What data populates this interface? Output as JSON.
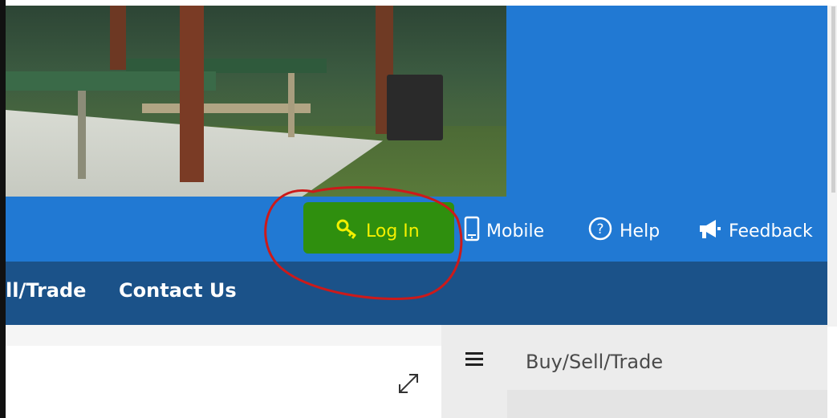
{
  "header": {
    "links": [
      {
        "id": "login",
        "label": "Log In",
        "icon": "key-icon"
      },
      {
        "id": "mobile",
        "label": "Mobile",
        "icon": "mobile-phone-icon"
      },
      {
        "id": "help",
        "label": "Help",
        "icon": "help-circle-icon"
      },
      {
        "id": "feedback",
        "label": "Feedback",
        "icon": "megaphone-icon"
      }
    ],
    "colors": {
      "header_blue": "#2179d3",
      "login_highlight": "#2f8f0e",
      "login_text": "#f3f000",
      "annotation_red": "#cc1a1a"
    }
  },
  "nav": {
    "items": [
      {
        "label": "ll/Trade"
      },
      {
        "label": "Contact Us"
      }
    ],
    "color": "#1b5289"
  },
  "side_panel": {
    "title": "Buy/Sell/Trade",
    "menu_icon": "hamburger-menu-icon"
  },
  "content": {
    "expand_icon": "expand-icon"
  }
}
